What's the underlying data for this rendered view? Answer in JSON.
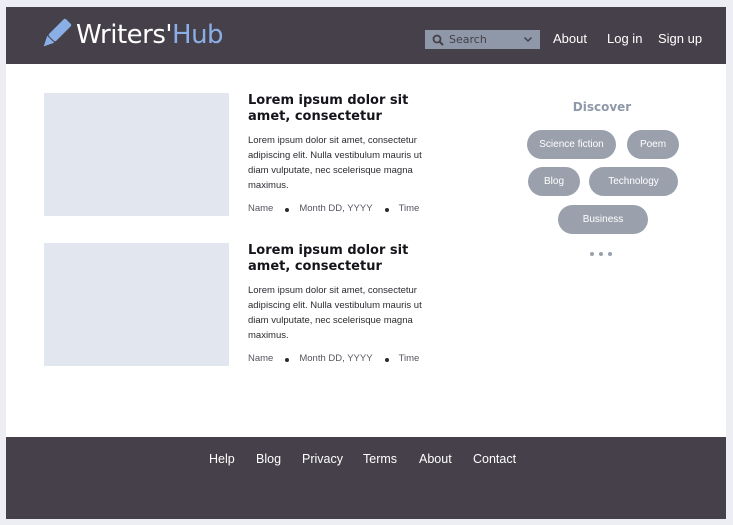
{
  "header": {
    "logo_primary": "Writers'",
    "logo_secondary": "Hub",
    "search_placeholder": "Search",
    "nav": [
      "About",
      "Log in",
      "Sign up"
    ]
  },
  "posts": [
    {
      "title": "Lorem ipsum dolor sit amet, consectetur",
      "body": "Lorem ipsum dolor sit amet, consectetur adipiscing elit. Nulla vestibulum mauris ut diam vulputate, nec scelerisque magna maximus.",
      "author": "Name",
      "date": "Month DD, YYYY",
      "time": "Time"
    },
    {
      "title": "Lorem ipsum dolor sit amet, consectetur",
      "body": "Lorem ipsum dolor sit amet, consectetur adipiscing elit. Nulla vestibulum mauris ut diam vulputate, nec scelerisque magna maximus.",
      "author": "Name",
      "date": "Month DD, YYYY",
      "time": "Time"
    }
  ],
  "discover": {
    "title": "Discover",
    "tags": [
      "Science fiction",
      "Poem",
      "Blog",
      "Technology",
      "Business"
    ]
  },
  "footer": {
    "links": [
      "Help",
      "Blog",
      "Privacy",
      "Terms",
      "About",
      "Contact"
    ]
  },
  "colors": {
    "header_bg": "#454049",
    "accent": "#8aaee6",
    "chip": "#9aa1ad",
    "placeholder": "#e2e6ef"
  }
}
